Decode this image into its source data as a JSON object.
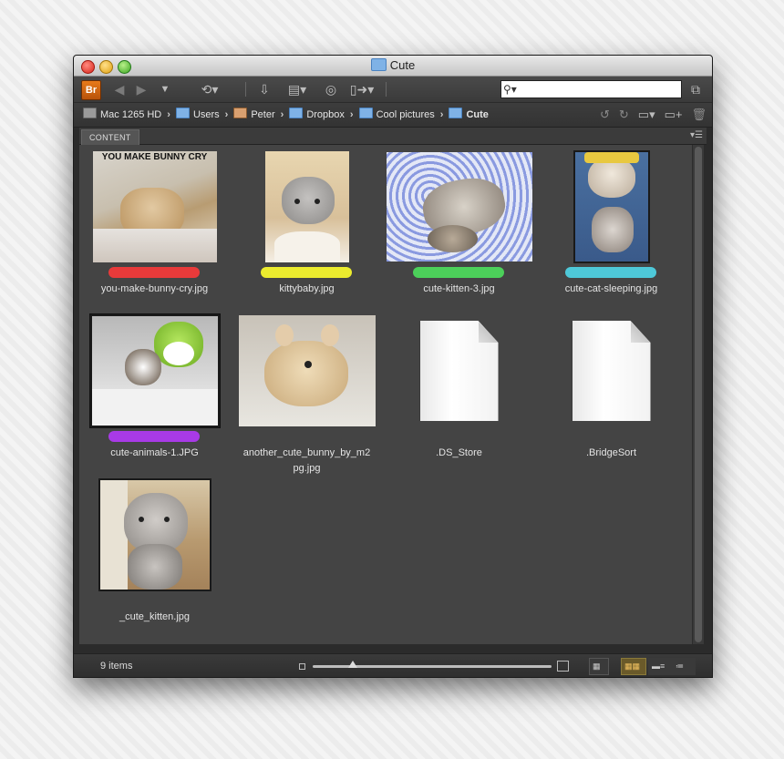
{
  "window": {
    "title": "Cute"
  },
  "toolbar": {
    "app_badge": "Br",
    "search": {
      "value": "",
      "placeholder": ""
    }
  },
  "path": {
    "crumbs": [
      {
        "label": "Mac 1265 HD",
        "icon": "hard-drive-icon"
      },
      {
        "label": "Users",
        "icon": "users-folder-icon"
      },
      {
        "label": "Peter",
        "icon": "home-icon"
      },
      {
        "label": "Dropbox",
        "icon": "dropbox-folder-icon"
      },
      {
        "label": "Cool pictures",
        "icon": "folder-icon"
      },
      {
        "label": "Cute",
        "icon": "folder-icon"
      }
    ]
  },
  "panel": {
    "tab": "CONTENT"
  },
  "items": [
    {
      "name": "you-make-bunny-cry.jpg",
      "label_color": "#e83a3a",
      "caption": "YOU MAKE BUNNY CRY"
    },
    {
      "name": "kittybaby.jpg",
      "label_color": "#ecec2e"
    },
    {
      "name": "cute-kitten-3.jpg",
      "label_color": "#4cd05a"
    },
    {
      "name": "cute-cat-sleeping.jpg",
      "label_color": "#4ec8d8"
    },
    {
      "name": "cute-animals-1.JPG",
      "label_color": "#a83ae6"
    },
    {
      "name": "another_cute_bunny_by_m2pg.jpg",
      "name_line1": "another_cute_bunny_by_m2",
      "name_line2": "pg.jpg"
    },
    {
      "name": ".DS_Store"
    },
    {
      "name": ".BridgeSort"
    },
    {
      "name": "_cute_kitten.jpg"
    }
  ],
  "status": {
    "count": "9 items"
  },
  "colors": {
    "accent": "#e87a1a",
    "panel_bg": "#444444",
    "chrome_bg": "#3a3a3a"
  }
}
